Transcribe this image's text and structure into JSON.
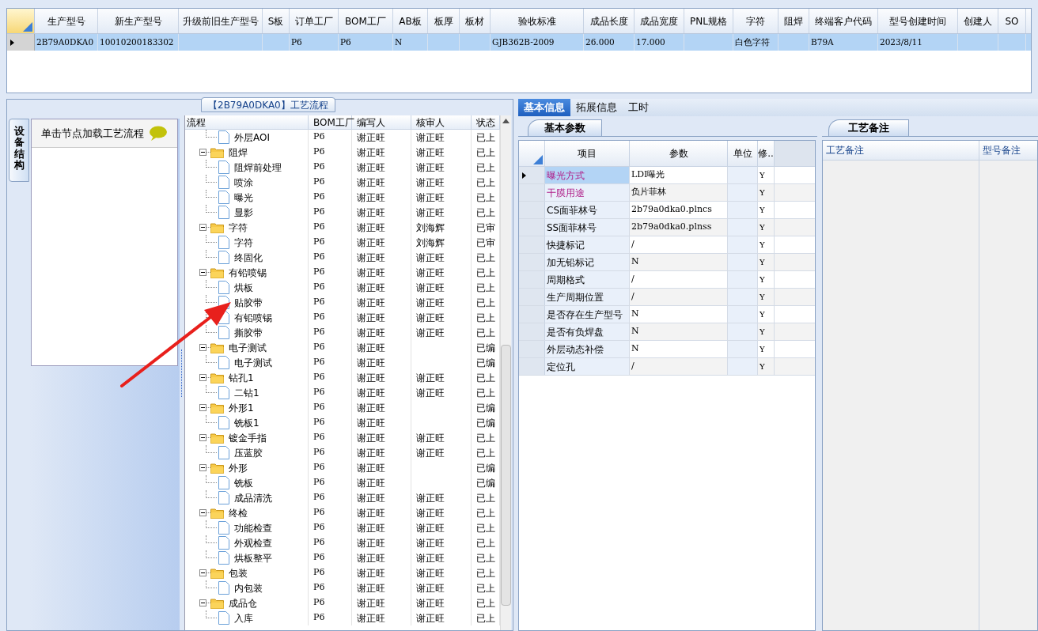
{
  "top_grid": {
    "columns": [
      "生产型号",
      "新生产型号",
      "升级前旧生产型号",
      "S板",
      "订单工厂",
      "BOM工厂",
      "AB板",
      "板厚",
      "板材",
      "验收标准",
      "成品长度",
      "成品宽度",
      "PNL规格",
      "字符",
      "阻焊",
      "终端客户代码",
      "型号创建时间",
      "创建人",
      "SO"
    ],
    "rows": [
      {
        "selected": true,
        "cells": [
          "2B79A0DKA0",
          "10010200183302",
          "",
          "",
          "P6",
          "P6",
          "N",
          "",
          "",
          "GJB362B-2009",
          "26.000",
          "17.000",
          "",
          "白色字符",
          "",
          "B79A",
          "2023/8/11",
          "",
          ""
        ]
      }
    ]
  },
  "flow_panel": {
    "title": "【2B79A0DKA0】工艺流程",
    "side_tab": "设备结构",
    "hint": "单击节点加载工艺流程",
    "tree": {
      "columns": [
        "流程",
        "BOM工厂",
        "编写人",
        "核审人",
        "状态"
      ],
      "rows": [
        {
          "kind": "step",
          "label": "外层AOI",
          "bom": "P6",
          "author": "谢正旺",
          "reviewer": "谢正旺",
          "status": "已上"
        },
        {
          "kind": "folder",
          "label": "阻焊",
          "bom": "P6",
          "author": "谢正旺",
          "reviewer": "谢正旺",
          "status": "已上",
          "expanded": true,
          "children": [
            {
              "kind": "step",
              "label": "阻焊前处理",
              "bom": "P6",
              "author": "谢正旺",
              "reviewer": "谢正旺",
              "status": "已上"
            },
            {
              "kind": "step",
              "label": "喷涂",
              "bom": "P6",
              "author": "谢正旺",
              "reviewer": "谢正旺",
              "status": "已上"
            },
            {
              "kind": "step",
              "label": "曝光",
              "bom": "P6",
              "author": "谢正旺",
              "reviewer": "谢正旺",
              "status": "已上"
            },
            {
              "kind": "step",
              "label": "显影",
              "bom": "P6",
              "author": "谢正旺",
              "reviewer": "谢正旺",
              "status": "已上"
            }
          ]
        },
        {
          "kind": "folder",
          "label": "字符",
          "bom": "P6",
          "author": "谢正旺",
          "reviewer": "刘海辉",
          "status": "已审",
          "expanded": true,
          "children": [
            {
              "kind": "step",
              "label": "字符",
              "bom": "P6",
              "author": "谢正旺",
              "reviewer": "刘海辉",
              "status": "已审"
            },
            {
              "kind": "step",
              "label": "终固化",
              "bom": "P6",
              "author": "谢正旺",
              "reviewer": "谢正旺",
              "status": "已上"
            }
          ]
        },
        {
          "kind": "folder",
          "label": "有铅喷锡",
          "bom": "P6",
          "author": "谢正旺",
          "reviewer": "谢正旺",
          "status": "已上",
          "expanded": true,
          "children": [
            {
              "kind": "step",
              "label": "烘板",
              "bom": "P6",
              "author": "谢正旺",
              "reviewer": "谢正旺",
              "status": "已上"
            },
            {
              "kind": "step",
              "label": "贴胶带",
              "bom": "P6",
              "author": "谢正旺",
              "reviewer": "谢正旺",
              "status": "已上"
            },
            {
              "kind": "step",
              "label": "有铅喷锡",
              "bom": "P6",
              "author": "谢正旺",
              "reviewer": "谢正旺",
              "status": "已上"
            },
            {
              "kind": "step",
              "label": "撕胶带",
              "bom": "P6",
              "author": "谢正旺",
              "reviewer": "谢正旺",
              "status": "已上"
            }
          ]
        },
        {
          "kind": "folder",
          "label": "电子测试",
          "bom": "P6",
          "author": "谢正旺",
          "status": "已编",
          "expanded": true,
          "children": [
            {
              "kind": "step",
              "label": "电子测试",
              "bom": "P6",
              "author": "谢正旺",
              "status": "已编"
            }
          ]
        },
        {
          "kind": "folder",
          "label": "钻孔1",
          "bom": "P6",
          "author": "谢正旺",
          "reviewer": "谢正旺",
          "status": "已上",
          "expanded": true,
          "children": [
            {
              "kind": "step",
              "label": "二钻1",
              "bom": "P6",
              "author": "谢正旺",
              "reviewer": "谢正旺",
              "status": "已上"
            }
          ]
        },
        {
          "kind": "folder",
          "label": "外形1",
          "bom": "P6",
          "author": "谢正旺",
          "status": "已编",
          "expanded": true,
          "children": [
            {
              "kind": "step",
              "label": "铣板1",
              "bom": "P6",
              "author": "谢正旺",
              "status": "已编"
            }
          ]
        },
        {
          "kind": "folder",
          "label": "镀金手指",
          "bom": "P6",
          "author": "谢正旺",
          "reviewer": "谢正旺",
          "status": "已上",
          "expanded": true,
          "children": [
            {
              "kind": "step",
              "label": "压蓝胶",
              "bom": "P6",
              "author": "谢正旺",
              "reviewer": "谢正旺",
              "status": "已上"
            }
          ]
        },
        {
          "kind": "folder",
          "label": "外形",
          "bom": "P6",
          "author": "谢正旺",
          "status": "已编",
          "expanded": true,
          "children": [
            {
              "kind": "step",
              "label": "铣板",
              "bom": "P6",
              "author": "谢正旺",
              "status": "已编"
            },
            {
              "kind": "step",
              "label": "成品清洗",
              "bom": "P6",
              "author": "谢正旺",
              "reviewer": "谢正旺",
              "status": "已上"
            }
          ]
        },
        {
          "kind": "folder",
          "label": "终检",
          "bom": "P6",
          "author": "谢正旺",
          "reviewer": "谢正旺",
          "status": "已上",
          "expanded": true,
          "children": [
            {
              "kind": "step",
              "label": "功能检查",
              "bom": "P6",
              "author": "谢正旺",
              "reviewer": "谢正旺",
              "status": "已上"
            },
            {
              "kind": "step",
              "label": "外观检查",
              "bom": "P6",
              "author": "谢正旺",
              "reviewer": "谢正旺",
              "status": "已上"
            },
            {
              "kind": "step",
              "label": "烘板整平",
              "bom": "P6",
              "author": "谢正旺",
              "reviewer": "谢正旺",
              "status": "已上"
            }
          ]
        },
        {
          "kind": "folder",
          "label": "包装",
          "bom": "P6",
          "author": "谢正旺",
          "reviewer": "谢正旺",
          "status": "已上",
          "expanded": true,
          "children": [
            {
              "kind": "step",
              "label": "内包装",
              "bom": "P6",
              "author": "谢正旺",
              "reviewer": "谢正旺",
              "status": "已上"
            }
          ]
        },
        {
          "kind": "folder",
          "label": "成品仓",
          "bom": "P6",
          "author": "谢正旺",
          "reviewer": "谢正旺",
          "status": "已上",
          "expanded": true,
          "children": [
            {
              "kind": "step",
              "label": "入库",
              "bom": "P6",
              "author": "谢正旺",
              "reviewer": "谢正旺",
              "status": "已上"
            }
          ]
        }
      ]
    }
  },
  "info_panel": {
    "tabs": [
      {
        "label": "基本信息",
        "selected": true
      },
      {
        "label": "拓展信息",
        "selected": false
      },
      {
        "label": "工时",
        "selected": false
      }
    ],
    "params_tab": "基本参数",
    "columns": [
      "项目",
      "参数",
      "单位",
      "修.."
    ],
    "rows": [
      {
        "item": "曝光方式",
        "value": "LDI曝光",
        "flag": "Y",
        "highlighted": true,
        "selected": true
      },
      {
        "item": "干膜用途",
        "value": "负片菲林",
        "flag": "Y",
        "highlighted": true,
        "selected": false
      },
      {
        "item": "CS面菲林号",
        "value": "2b79a0dka0.plncs",
        "flag": "Y",
        "highlighted": false,
        "selected": false
      },
      {
        "item": "SS面菲林号",
        "value": "2b79a0dka0.plnss",
        "flag": "Y",
        "highlighted": false,
        "selected": false
      },
      {
        "item": "快捷标记",
        "value": "/",
        "flag": "Y",
        "highlighted": false,
        "selected": false
      },
      {
        "item": "加无铅标记",
        "value": "N",
        "flag": "Y",
        "highlighted": false,
        "selected": false
      },
      {
        "item": "周期格式",
        "value": "/",
        "flag": "Y",
        "highlighted": false,
        "selected": false
      },
      {
        "item": "生产周期位置",
        "value": "/",
        "flag": "Y",
        "highlighted": false,
        "selected": false
      },
      {
        "item": "是否存在生产型号",
        "value": "N",
        "flag": "Y",
        "highlighted": false,
        "selected": false
      },
      {
        "item": "是否有负焊盘",
        "value": "N",
        "flag": "Y",
        "highlighted": false,
        "selected": false
      },
      {
        "item": "外层动态补偿",
        "value": "N",
        "flag": "Y",
        "highlighted": false,
        "selected": false
      },
      {
        "item": "定位孔",
        "value": "/",
        "flag": "Y",
        "highlighted": false,
        "selected": false
      }
    ],
    "notes_tab": "工艺备注",
    "notes_columns": [
      "工艺备注",
      "型号备注"
    ]
  }
}
